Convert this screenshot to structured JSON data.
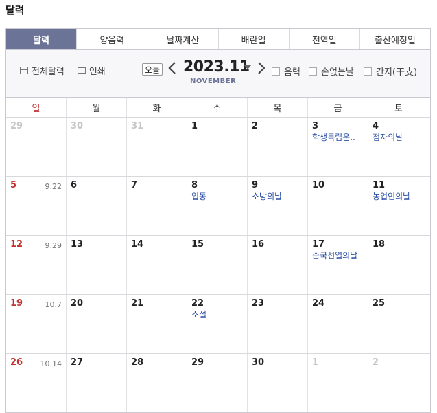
{
  "page_title": "달력",
  "tabs": [
    {
      "label": "달력",
      "active": true
    },
    {
      "label": "양음력",
      "active": false
    },
    {
      "label": "날짜계산",
      "active": false
    },
    {
      "label": "배란일",
      "active": false
    },
    {
      "label": "전역일",
      "active": false
    },
    {
      "label": "출산예정일",
      "active": false
    }
  ],
  "toolbar": {
    "full_calendar": "전체달력",
    "print": "인쇄",
    "today": "오늘",
    "prev_icon": "chevron-left-icon",
    "next_icon": "chevron-right-icon",
    "month": "2023.11",
    "month_name": "NOVEMBER",
    "options": [
      {
        "label": "음력",
        "checked": false
      },
      {
        "label": "손없는날",
        "checked": false
      },
      {
        "label": "간지(干支)",
        "checked": false
      }
    ]
  },
  "weekdays": [
    "일",
    "월",
    "화",
    "수",
    "목",
    "금",
    "토"
  ],
  "colors": {
    "accent": "#6b7396",
    "sunday": "#c23030",
    "event": "#2c4fa3"
  },
  "weeks": [
    [
      {
        "day": "29",
        "other": true,
        "lunar": "",
        "event": ""
      },
      {
        "day": "30",
        "other": true,
        "lunar": "",
        "event": ""
      },
      {
        "day": "31",
        "other": true,
        "lunar": "",
        "event": ""
      },
      {
        "day": "1",
        "other": false,
        "lunar": "",
        "event": ""
      },
      {
        "day": "2",
        "other": false,
        "lunar": "",
        "event": ""
      },
      {
        "day": "3",
        "other": false,
        "lunar": "",
        "event": "학생독립운.."
      },
      {
        "day": "4",
        "other": false,
        "lunar": "",
        "event": "점자의날"
      }
    ],
    [
      {
        "day": "5",
        "other": false,
        "lunar": "9.22",
        "event": ""
      },
      {
        "day": "6",
        "other": false,
        "lunar": "",
        "event": ""
      },
      {
        "day": "7",
        "other": false,
        "lunar": "",
        "event": ""
      },
      {
        "day": "8",
        "other": false,
        "lunar": "",
        "event": "입동"
      },
      {
        "day": "9",
        "other": false,
        "lunar": "",
        "event": "소방의날"
      },
      {
        "day": "10",
        "other": false,
        "lunar": "",
        "event": ""
      },
      {
        "day": "11",
        "other": false,
        "lunar": "",
        "event": "농업인의날"
      }
    ],
    [
      {
        "day": "12",
        "other": false,
        "lunar": "9.29",
        "event": ""
      },
      {
        "day": "13",
        "other": false,
        "lunar": "",
        "event": ""
      },
      {
        "day": "14",
        "other": false,
        "lunar": "",
        "event": ""
      },
      {
        "day": "15",
        "other": false,
        "lunar": "",
        "event": ""
      },
      {
        "day": "16",
        "other": false,
        "lunar": "",
        "event": ""
      },
      {
        "day": "17",
        "other": false,
        "lunar": "",
        "event": "순국선열의날"
      },
      {
        "day": "18",
        "other": false,
        "lunar": "",
        "event": ""
      }
    ],
    [
      {
        "day": "19",
        "other": false,
        "lunar": "10.7",
        "event": ""
      },
      {
        "day": "20",
        "other": false,
        "lunar": "",
        "event": ""
      },
      {
        "day": "21",
        "other": false,
        "lunar": "",
        "event": ""
      },
      {
        "day": "22",
        "other": false,
        "lunar": "",
        "event": "소설"
      },
      {
        "day": "23",
        "other": false,
        "lunar": "",
        "event": ""
      },
      {
        "day": "24",
        "other": false,
        "lunar": "",
        "event": ""
      },
      {
        "day": "25",
        "other": false,
        "lunar": "",
        "event": ""
      }
    ],
    [
      {
        "day": "26",
        "other": false,
        "lunar": "10.14",
        "event": ""
      },
      {
        "day": "27",
        "other": false,
        "lunar": "",
        "event": ""
      },
      {
        "day": "28",
        "other": false,
        "lunar": "",
        "event": ""
      },
      {
        "day": "29",
        "other": false,
        "lunar": "",
        "event": ""
      },
      {
        "day": "30",
        "other": false,
        "lunar": "",
        "event": ""
      },
      {
        "day": "1",
        "other": true,
        "lunar": "",
        "event": ""
      },
      {
        "day": "2",
        "other": true,
        "lunar": "",
        "event": ""
      }
    ]
  ]
}
